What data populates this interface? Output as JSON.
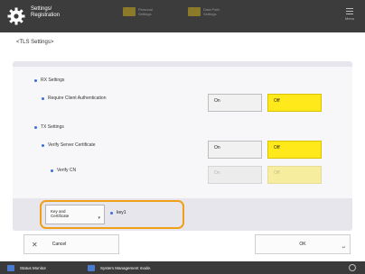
{
  "header": {
    "title_line1": "Settings/",
    "title_line2": "Registration",
    "tab1_line1": "Personal",
    "tab1_line2": "Settings",
    "tab2_line1": "Data Path",
    "tab2_line2": "Settings",
    "menu_label": "Menu"
  },
  "page": {
    "title": "<TLS Settings>"
  },
  "rx": {
    "heading": "RX Settings",
    "require_client_auth": {
      "label": "Require Client Authentication",
      "on": "On",
      "off": "Off",
      "selected": "Off"
    }
  },
  "tx": {
    "heading": "TX Settings",
    "verify_server_cert": {
      "label": "Verify Server Certificate",
      "on": "On",
      "off": "Off",
      "selected": "Off"
    },
    "verify_cn": {
      "label": "Verify CN",
      "on": "On",
      "off": "Off",
      "selected": "Off",
      "disabled": true
    }
  },
  "key": {
    "button_line1": "Key and",
    "button_line2": "Certificate",
    "value": "key1"
  },
  "footer": {
    "cancel_label": "Cancel",
    "ok_label": "OK"
  },
  "statusbar": {
    "status_monitor": "Status Monitor",
    "system_mode": "System Management mode."
  },
  "colors": {
    "selected": "#ffe91a",
    "highlight": "#f0a018",
    "accent": "#3a6fd8"
  }
}
